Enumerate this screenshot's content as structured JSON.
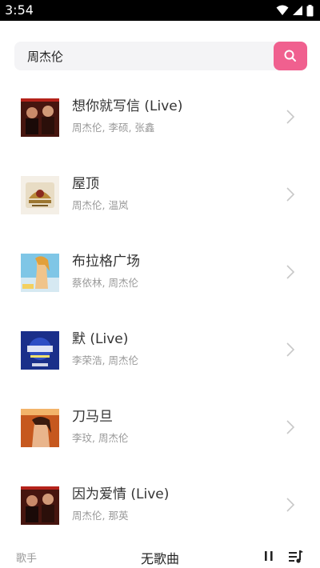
{
  "status_bar": {
    "time": "3:54",
    "icons": [
      "wifi-icon",
      "signal-icon",
      "battery-icon"
    ]
  },
  "search": {
    "value": "周杰伦",
    "button_icon": "search-icon",
    "accent_color": "#f0608f"
  },
  "songs": [
    {
      "title": "想你就写信 (Live)",
      "artists": "周杰伦, 李硕, 张鑫"
    },
    {
      "title": "屋顶",
      "artists": "周杰伦, 温岚"
    },
    {
      "title": "布拉格广场",
      "artists": "蔡依林, 周杰伦"
    },
    {
      "title": "默 (Live)",
      "artists": "李荣浩, 周杰伦"
    },
    {
      "title": "刀马旦",
      "artists": "李玟, 周杰伦"
    },
    {
      "title": "因为爱情 (Live)",
      "artists": "周杰伦, 那英"
    }
  ],
  "player": {
    "artist": "歌手",
    "title": "无歌曲",
    "play_pause_icon": "pause-icon",
    "playlist_icon": "playlist-icon"
  }
}
